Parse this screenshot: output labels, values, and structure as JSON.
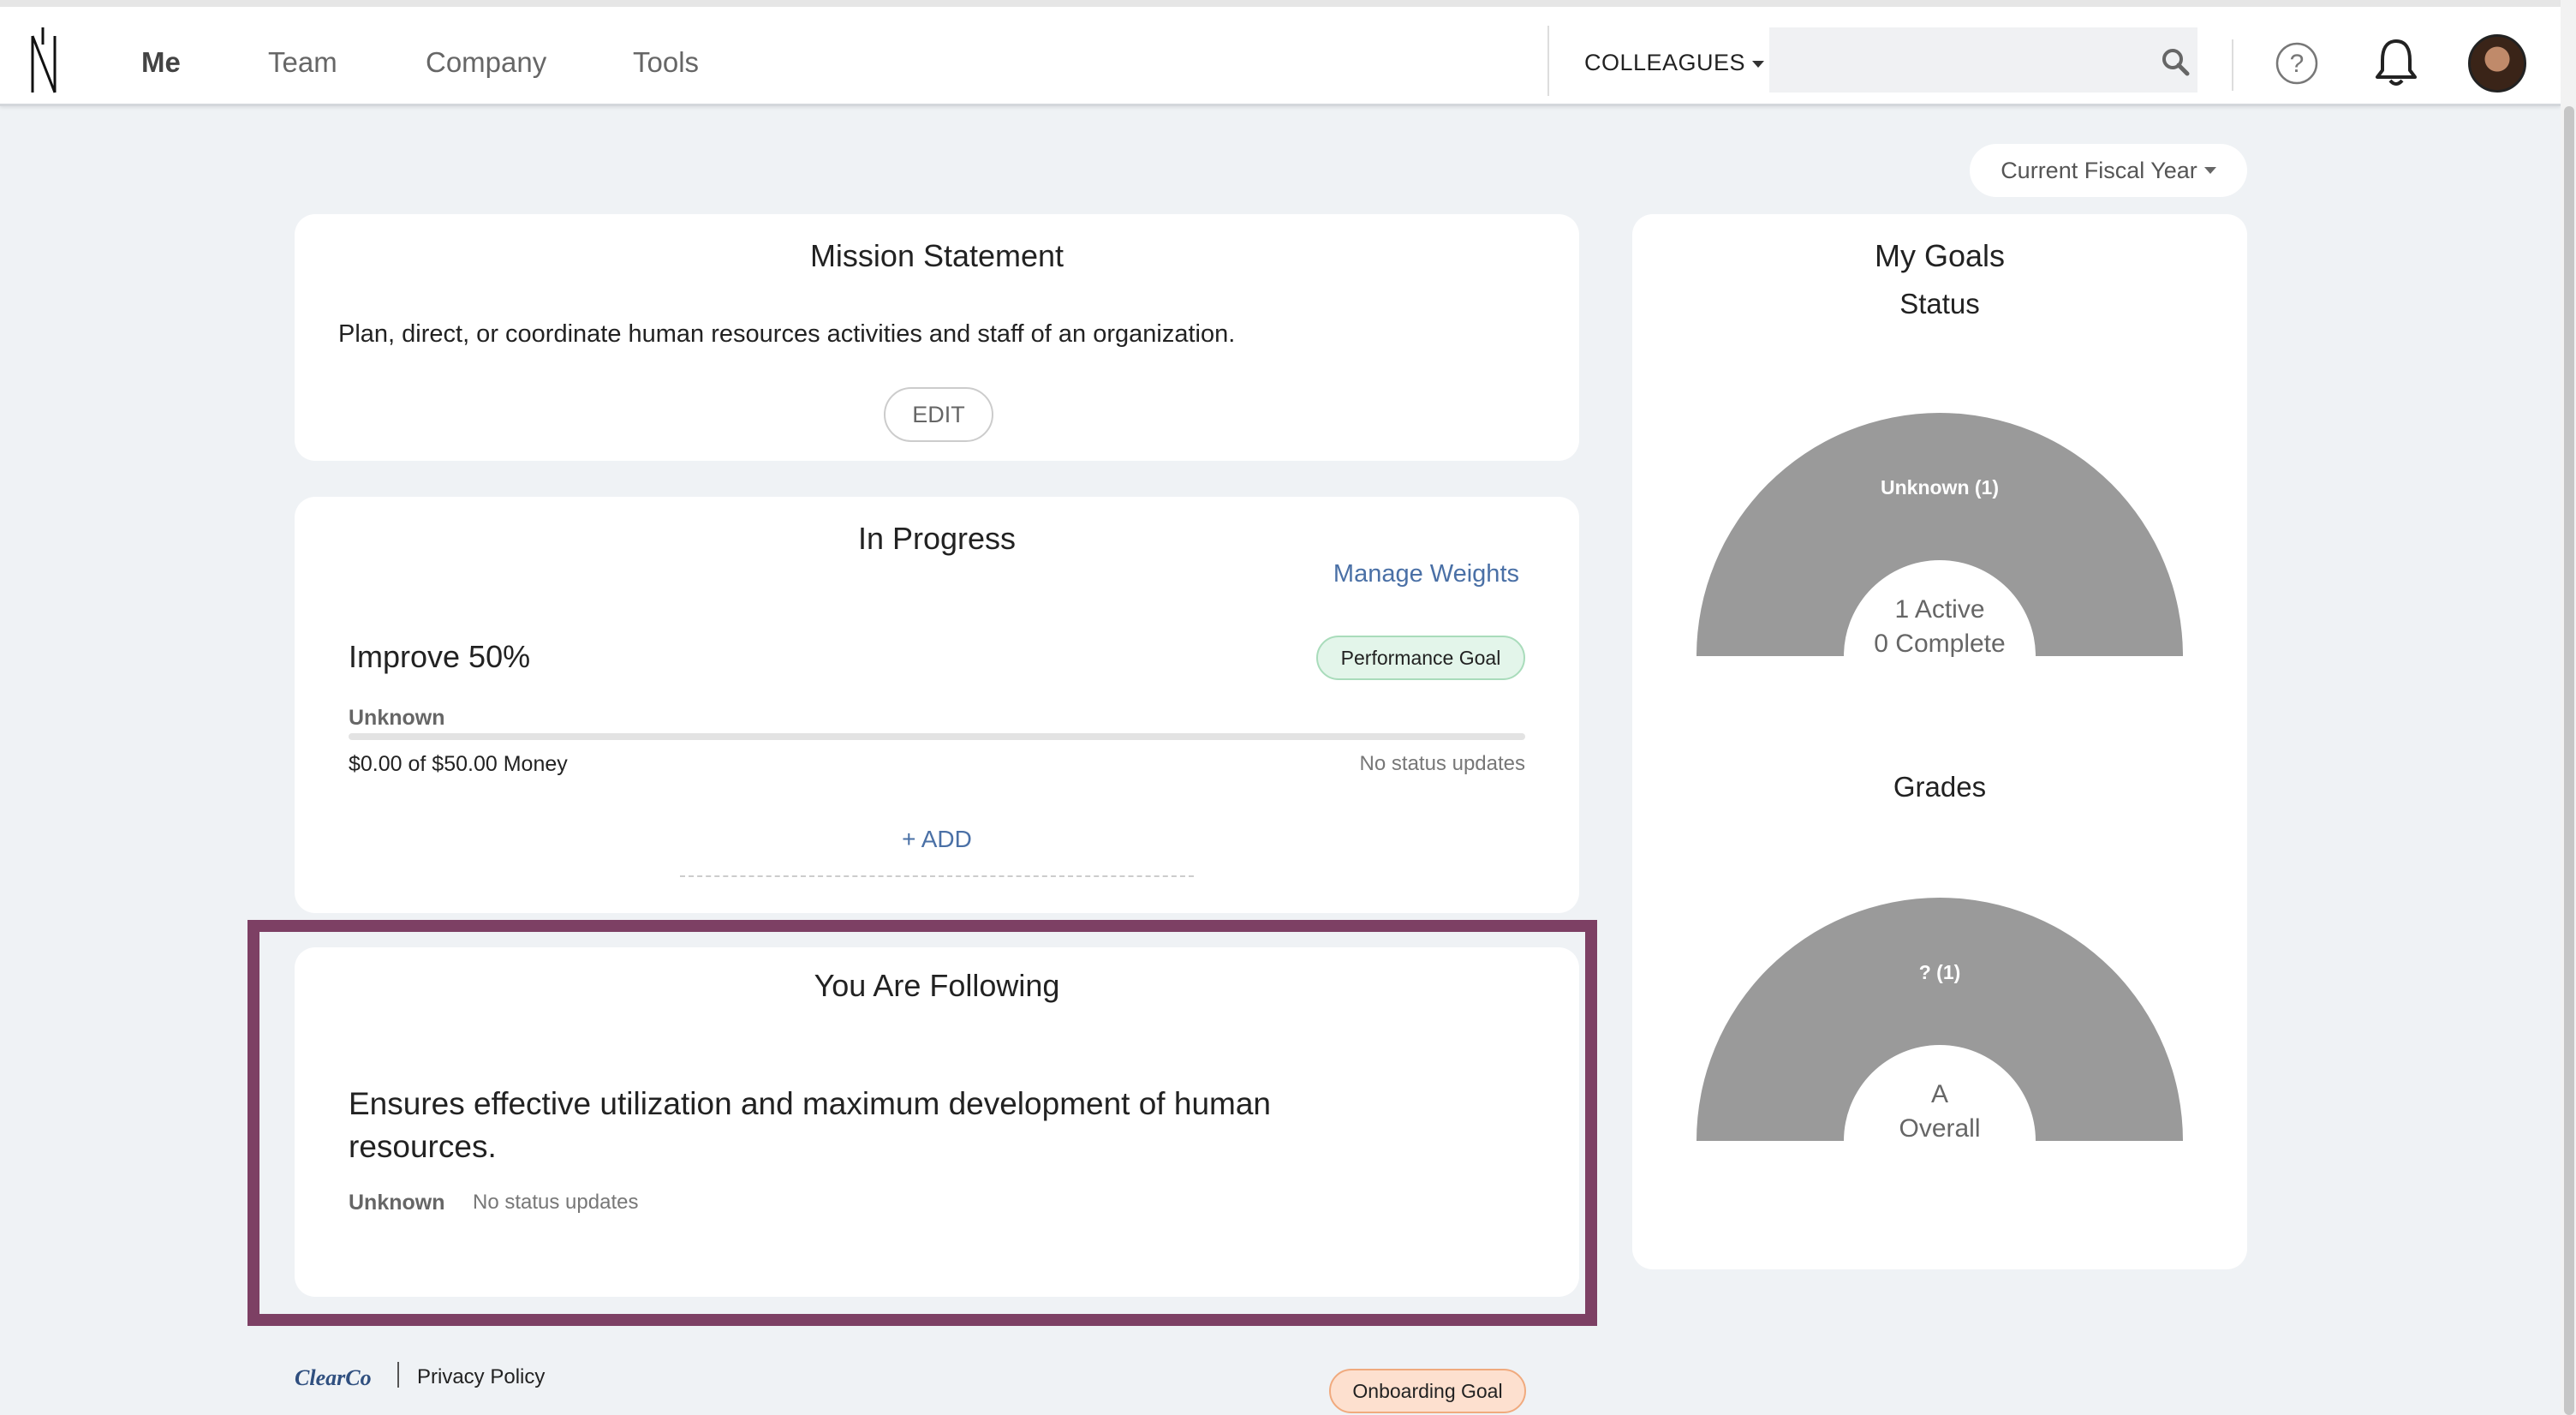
{
  "nav": {
    "items": [
      {
        "label": "Me",
        "active": true
      },
      {
        "label": "Team"
      },
      {
        "label": "Company"
      },
      {
        "label": "Tools"
      }
    ],
    "colleagues_label": "COLLEAGUES",
    "search_value": ""
  },
  "filter": {
    "fiscal_label": "Current Fiscal Year"
  },
  "mission": {
    "title": "Mission Statement",
    "text": "Plan, direct, or coordinate human resources activities and staff of an organization.",
    "edit_label": "EDIT"
  },
  "in_progress": {
    "title": "In Progress",
    "manage_weights_label": "Manage Weights",
    "goal": {
      "title": "Improve 50%",
      "badge": "Performance Goal",
      "status": "Unknown",
      "progress": 0,
      "amount": "$0.00 of $50.00 Money",
      "updates": "No status updates"
    },
    "add_label": "+ ADD"
  },
  "following": {
    "title": "You Are Following",
    "goal": {
      "title": "Ensures effective utilization and maximum development of human resources.",
      "badge": "Onboarding Goal",
      "status": "Unknown",
      "updates": "No status updates"
    }
  },
  "my_goals": {
    "title": "My Goals",
    "status_title": "Status",
    "status_gauge": {
      "slice_label": "Unknown (1)",
      "center_line1": "1 Active",
      "center_line2": "0 Complete"
    },
    "grades_title": "Grades",
    "grades_gauge": {
      "slice_label": "? (1)",
      "center_line1": "A",
      "center_line2": "Overall"
    }
  },
  "colors": {
    "accent": "#4a70a6",
    "highlight": "#7d4064",
    "gauge": "#9a9a9a"
  },
  "footer": {
    "brand": "ClearCo",
    "privacy_label": "Privacy Policy"
  }
}
